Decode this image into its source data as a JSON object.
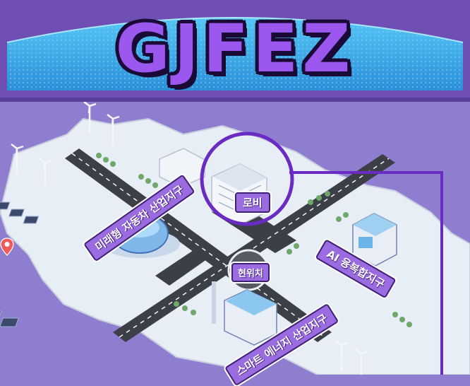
{
  "header": {
    "title": "GJFEZ",
    "colors": {
      "banner": "#6f4fb4",
      "arc": "#3fb8ef",
      "title_fill": "#9b57ee",
      "title_outline": "#1a0a36"
    }
  },
  "map": {
    "lobby_label": "로비",
    "current_location_label": "현위치",
    "districts": {
      "auto": "미래형 자동차 산업지구",
      "ai": "AI 융복합지구",
      "smart_energy": "스마트 에너지 산업지구"
    },
    "icons": {
      "location": "location-pin-icon",
      "highlight": "lobby-highlight-circle"
    },
    "colors": {
      "background": "#8f7ed0",
      "ground": "#e8eef5",
      "road": "#3c3f46",
      "highlight": "#6a2bc2",
      "label": "#9b6be0"
    }
  }
}
